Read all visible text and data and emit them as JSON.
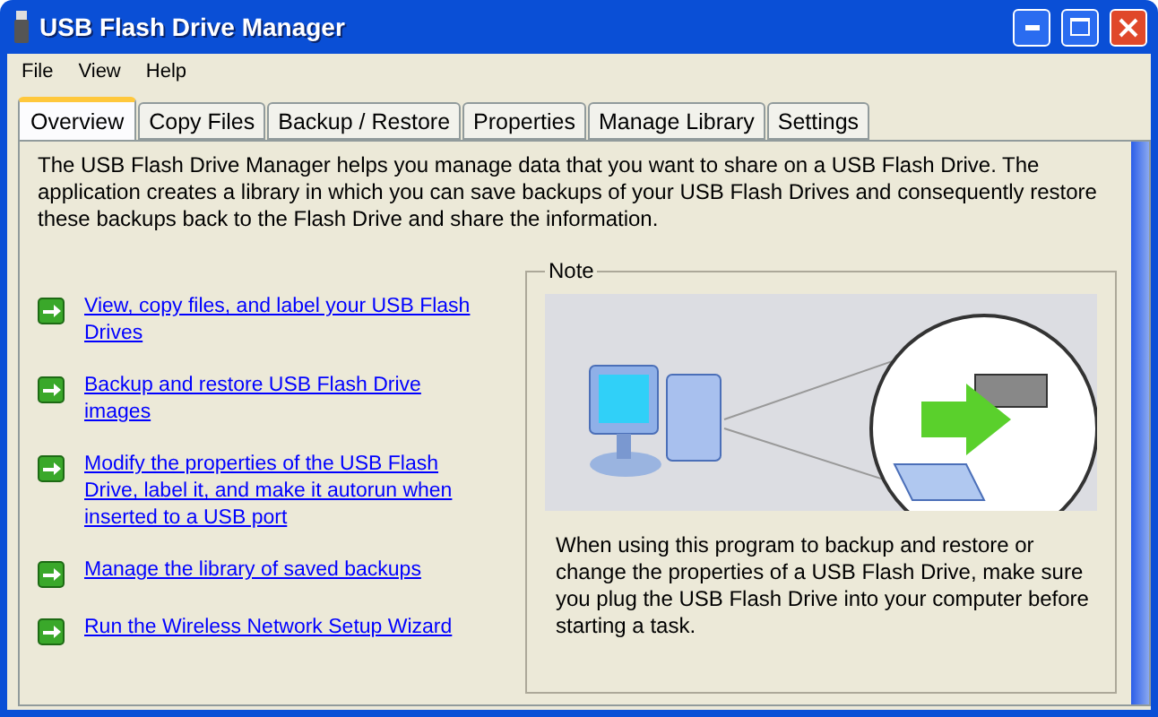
{
  "window": {
    "title": "USB Flash Drive Manager"
  },
  "menu": [
    "File",
    "View",
    "Help"
  ],
  "tabs": [
    {
      "label": "Overview",
      "selected": true
    },
    {
      "label": "Copy Files",
      "selected": false
    },
    {
      "label": "Backup / Restore",
      "selected": false
    },
    {
      "label": "Properties",
      "selected": false
    },
    {
      "label": "Manage Library",
      "selected": false
    },
    {
      "label": "Settings",
      "selected": false
    }
  ],
  "intro": "The USB Flash Drive Manager helps you manage data that you want to share on a USB Flash Drive. The application creates a library in which you can save backups of your USB Flash Drives and consequently restore these backups back to the Flash Drive and share the information.",
  "links": [
    "View, copy files, and label your USB Flash Drives",
    "Backup and restore USB Flash Drive images",
    "Modify the properties of the USB Flash Drive, label it, and make it autorun when inserted to a USB port",
    "Manage the library of saved backups",
    "Run the Wireless Network Setup Wizard"
  ],
  "note": {
    "title": "Note",
    "text": "When using this program to backup and restore or change the properties of a USB Flash Drive, make sure you plug the USB Flash Drive into your computer before starting a task."
  }
}
